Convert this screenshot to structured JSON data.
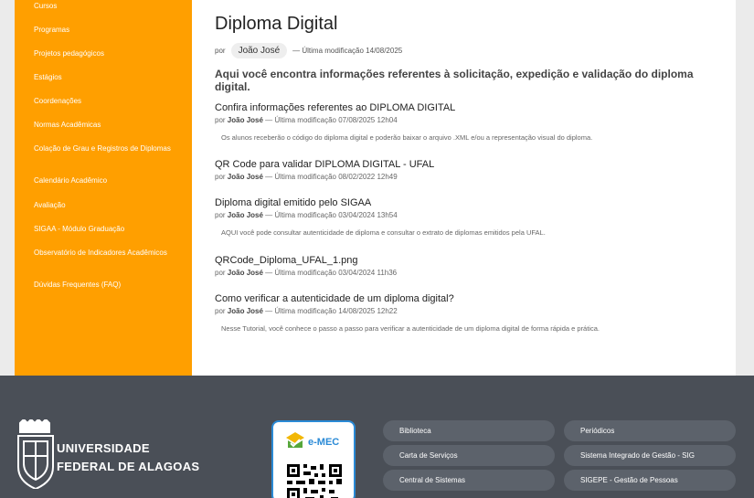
{
  "sidebar": {
    "items": [
      "Cursos",
      "Programas",
      "Projetos pedagógicos",
      "Estágios",
      "Coordenações",
      "Normas Acadêmicas",
      "Colação de Grau e Registros de Diplomas",
      "Calendário Acadêmico",
      "Avaliação",
      "SIGAA - Módulo Graduação",
      "Observatório de Indicadores Acadêmicos",
      "Dúvidas Frequentes (FAQ)"
    ]
  },
  "page": {
    "title": "Diploma Digital",
    "by_label": "por",
    "author": "João José",
    "modified": "— Última modificação 14/08/2025",
    "lead": "Aqui você encontra informações referentes à solicitação, expedição e validação do diploma digital."
  },
  "items": [
    {
      "title": "Confira informações referentes ao DIPLOMA DIGITAL",
      "by": "por",
      "author": "João José",
      "modified": "— Última modificação 07/08/2025 12h04",
      "description": "Os alunos receberão o código do diploma digital e poderão baixar o arquivo .XML e/ou a representação visual do diploma."
    },
    {
      "title": "QR Code para validar DIPLOMA DIGITAL - UFAL",
      "by": "por",
      "author": "João José",
      "modified": "— Última modificação 08/02/2022 12h49",
      "description": ""
    },
    {
      "title": "Diploma digital emitido pelo SIGAA",
      "by": "por",
      "author": "João José",
      "modified": "— Última modificação 03/04/2024 13h54",
      "description": "AQUI você pode consultar autenticidade de diploma e consultar o extrato de diplomas emitidos pela UFAL."
    },
    {
      "title": "QRCode_Diploma_UFAL_1.png",
      "by": "por",
      "author": "João José",
      "modified": "— Última modificação 03/04/2024 11h36",
      "description": ""
    },
    {
      "title": "Como verificar a autenticidade de um diploma digital?",
      "by": "por",
      "author": "João José",
      "modified": "— Última modificação 14/08/2025 12h22",
      "description": "Nesse Tutorial, você conhece o passo a passo para verificar a autenticidade de um diploma digital de forma rápida e prática."
    }
  ],
  "footer": {
    "university_line1": "UNIVERSIDADE",
    "university_line2": "FEDERAL DE ALAGOAS",
    "emec_label": "e-MEC",
    "links_col1": [
      "Biblioteca",
      "Carta de Serviços",
      "Central de Sistemas"
    ],
    "links_col2": [
      "Periódicos",
      "Sistema Integrado de Gestão - SIG",
      "SIGEPE - Gestão de Pessoas"
    ]
  },
  "colors": {
    "sidebar": "#ff9f00",
    "footer": "#4a4f57",
    "emec_blue": "#2a8ad6"
  }
}
